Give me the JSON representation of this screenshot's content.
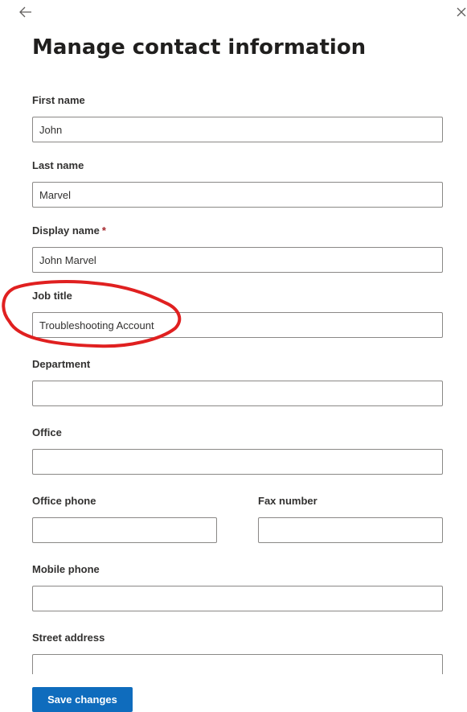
{
  "header": {
    "title": "Manage contact information"
  },
  "icons": {
    "back": "arrow-left-icon",
    "close": "close-icon"
  },
  "fields": {
    "first_name": {
      "label": "First name",
      "value": "John"
    },
    "last_name": {
      "label": "Last name",
      "value": "Marvel"
    },
    "display_name": {
      "label": "Display name",
      "required_marker": "*",
      "value": "John Marvel"
    },
    "job_title": {
      "label": "Job title",
      "value": "Troubleshooting Account"
    },
    "department": {
      "label": "Department",
      "value": ""
    },
    "office": {
      "label": "Office",
      "value": ""
    },
    "office_phone": {
      "label": "Office phone",
      "value": ""
    },
    "fax_number": {
      "label": "Fax number",
      "value": ""
    },
    "mobile_phone": {
      "label": "Mobile phone",
      "value": ""
    },
    "street_address": {
      "label": "Street address",
      "value": ""
    }
  },
  "footer": {
    "save_label": "Save changes"
  },
  "colors": {
    "primary": "#0f6cbd",
    "required": "#a4262c",
    "annotation": "#e02020",
    "border": "#8a8886"
  }
}
